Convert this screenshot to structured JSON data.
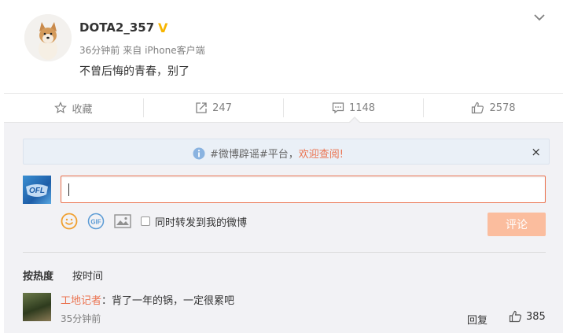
{
  "post": {
    "author": "DOTA2_357",
    "verified_badge": "V",
    "time": "36分钟前",
    "source": "来自 iPhone客户端",
    "content": "不曾后悔的青春，别了"
  },
  "actions": {
    "favorite_label": "收藏",
    "repost_count": "247",
    "comment_count": "1148",
    "like_count": "2578"
  },
  "notice": {
    "text": "#微博辟谣#平台，",
    "link": "欢迎查阅!",
    "close": "×"
  },
  "composer": {
    "forward_label": "同时转发到我的微博",
    "submit_label": "评论"
  },
  "sort": {
    "by_hot": "按热度",
    "by_time": "按时间"
  },
  "comments": [
    {
      "name": "工地记者",
      "text": "：背了一年的锅，一定很累吧",
      "time": "35分钟前",
      "reply_label": "回复",
      "likes": "385"
    }
  ],
  "colors": {
    "accent": "#eb7350",
    "verified": "#f7b500",
    "submit_disabled": "#fbbd9e"
  }
}
